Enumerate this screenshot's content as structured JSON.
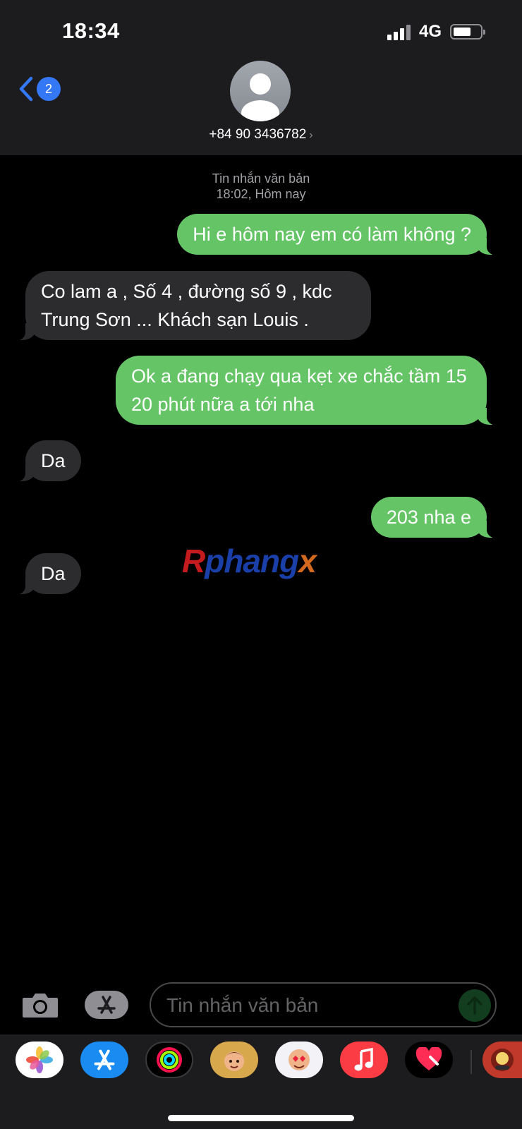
{
  "status_bar": {
    "time": "18:34",
    "network": "4G"
  },
  "header": {
    "back_badge": "2",
    "contact": "+84 90 3436782",
    "contact_chevron": "›"
  },
  "timestamp": {
    "line1": "Tin nhắn văn bản",
    "line2": "18:02, Hôm nay"
  },
  "messages": [
    {
      "direction": "outgoing",
      "text": "Hi e hôm nay em có làm không ?"
    },
    {
      "direction": "incoming",
      "text": "Co lam a , Số 4 , đường số 9 , kdc Trung Sơn ... Khách sạn Louis ."
    },
    {
      "direction": "outgoing",
      "text": "Ok a đang chạy qua kẹt xe chắc tầm 15 20 phút nữa a tới nha"
    },
    {
      "direction": "incoming",
      "text": "Da"
    },
    {
      "direction": "outgoing",
      "text": "203 nha e"
    },
    {
      "direction": "incoming",
      "text": "Da"
    }
  ],
  "watermark": {
    "part1": "R",
    "part2": "phang",
    "part3": "x"
  },
  "composer": {
    "placeholder": "Tin nhắn văn bản"
  },
  "app_drawer": [
    "photos-icon",
    "app-store-icon",
    "activity-icon",
    "memoji-icon",
    "animoji-icon",
    "music-icon",
    "heart-sticker-icon",
    "game-icon"
  ],
  "colors": {
    "outgoing_bubble": "#65c466",
    "incoming_bubble": "#2c2c2e",
    "accent": "#3478f6",
    "bar_bg": "#1c1c1e"
  }
}
